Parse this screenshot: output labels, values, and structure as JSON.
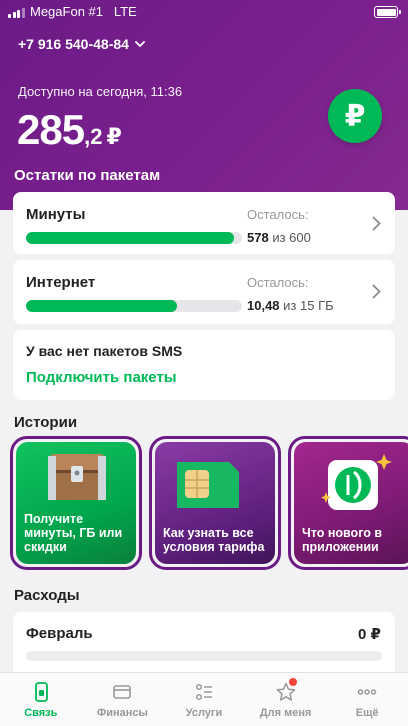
{
  "status_bar": {
    "carrier": "MegaFon #1",
    "network": "LTE"
  },
  "header": {
    "phone": "+7 916 540-48-84",
    "available_label": "Доступно на сегодня, 11:36",
    "balance_int": "285",
    "balance_dec": ",2",
    "currency": "₽",
    "topup_icon": "ruble-icon"
  },
  "packages": {
    "title": "Остатки по пакетам",
    "items": [
      {
        "name": "Минуты",
        "left_label": "Осталось:",
        "remaining": "578",
        "of_text": "из 600",
        "fraction": 0.963
      },
      {
        "name": "Интернет",
        "left_label": "Осталось:",
        "remaining": "10,48",
        "of_text": "из 15 ГБ",
        "fraction": 0.699
      }
    ],
    "sms": {
      "text": "У вас нет пакетов SMS",
      "link": "Подключить пакеты"
    }
  },
  "stories": {
    "title": "Истории",
    "items": [
      {
        "text": "Получите минуты, ГБ или скидки"
      },
      {
        "text": "Как узнать все условия тарифа"
      },
      {
        "text": "Что нового в приложении"
      }
    ]
  },
  "expenses": {
    "title": "Расходы",
    "month": "Февраль",
    "amount": "0 ₽"
  },
  "tabs": [
    {
      "label": "Связь",
      "icon": "phone-icon",
      "active": true
    },
    {
      "label": "Финансы",
      "icon": "wallet-icon",
      "active": false
    },
    {
      "label": "Услуги",
      "icon": "services-icon",
      "active": false
    },
    {
      "label": "Для меня",
      "icon": "star-icon",
      "active": false
    },
    {
      "label": "Ещё",
      "icon": "more-icon",
      "active": false
    }
  ],
  "colors": {
    "brand_purple": "#731e8a",
    "brand_green": "#00b956",
    "notification_red": "#f0433c"
  }
}
